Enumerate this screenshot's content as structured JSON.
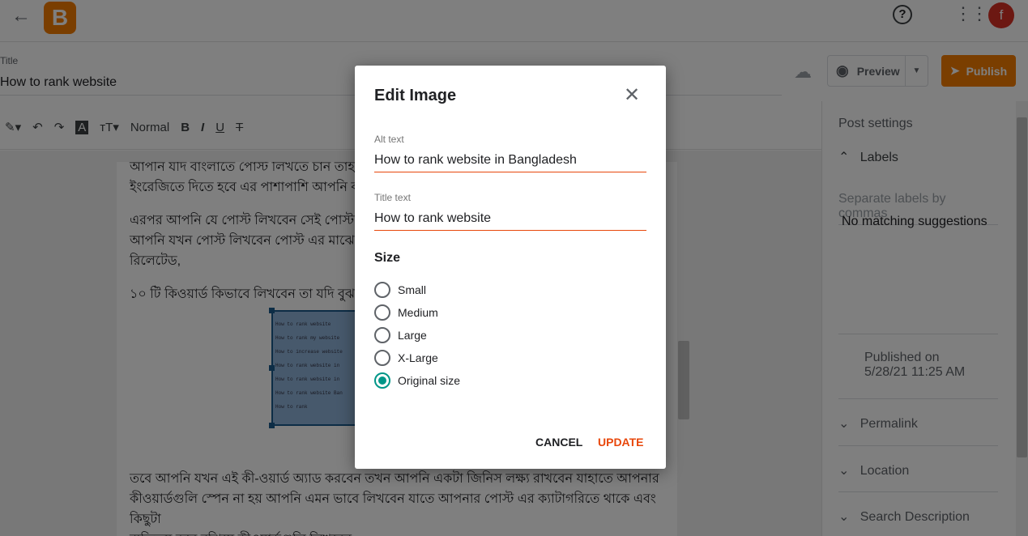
{
  "header": {
    "title_label": "Title",
    "title_value": "How to rank website",
    "preview_label": "Preview",
    "publish_label": "Publish",
    "avatar_letter": "f"
  },
  "toolbar": {
    "format_value": "Normal"
  },
  "editor": {
    "paragraphs": [
      "আপনি যদি বাংলাতে পোস্ট লিখতে চান তাহলে আ",
      "ইংরেজিতে দিতে হবে এর পাশাপাশি আপনি বাংলা",
      "এরপর আপনি যে পোস্ট লিখবেন সেই পোস্টটি স",
      "আপনি যখন পোস্ট লিখবেন পোস্ট এর মাঝে আপ",
      "রিলেটেড,",
      "১০ টি কিওয়ার্ড কিভাবে লিখবেন তা যদি বুঝতে ন",
      "তবে আপনি যখন এই কী-ওয়ার্ড অ্যাড করবেন তখন আপনি একটা জিনিস লক্ষ্য রাখবেন যাহাতে আপনার",
      "কীওয়ার্ডগুলি স্পেন না হয় আপনি এমন ভাবে লিখবেন যাতে আপনার পোস্ট এর ক্যাটাগরিতে থাকে এবং কিছুটা",
      "ব্যতিক্রম করে বুঝিয়ে কীওয়ার্ডগুলি লিখবেন,"
    ],
    "image_lines": [
      "How to rank website",
      "How to rank my website",
      "How to increase website",
      "How to rank website in",
      "How to rank website in",
      "How to rank website Ban",
      "How to rank"
    ]
  },
  "sidebar": {
    "heading": "Post settings",
    "labels": "Labels",
    "labels_placeholder": "Separate labels by commas",
    "no_suggestions": "No matching suggestions",
    "published_on": "Published on",
    "published_date": "5/28/21 11:25 AM",
    "permalink": "Permalink",
    "location": "Location",
    "search_description": "Search Description"
  },
  "dialog": {
    "title": "Edit Image",
    "alt_label": "Alt text",
    "alt_value": "How to rank website in Bangladesh",
    "title_label": "Title text",
    "title_value": "How to rank website",
    "size_label": "Size",
    "sizes": [
      "Small",
      "Medium",
      "Large",
      "X-Large",
      "Original size"
    ],
    "selected_size": "Original size",
    "cancel": "CANCEL",
    "update": "UPDATE"
  },
  "colors": {
    "accent": "#f57d00",
    "radio": "#009688",
    "update": "#e8470b"
  }
}
